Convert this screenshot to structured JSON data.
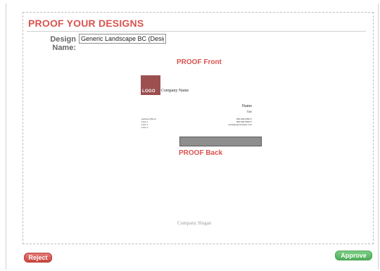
{
  "page": {
    "title": "PROOF YOUR DESIGNS"
  },
  "design": {
    "label": "Design Name:",
    "value": "Generic Landscape BC (Design Ed"
  },
  "proof": {
    "front_heading": "PROOF Front",
    "back_heading": "PROOF Back"
  },
  "card": {
    "logo_text": "LOGO",
    "company_name": "Company Name",
    "person_name": "Name",
    "person_title": "Title",
    "address_lines": [
      "Address Block",
      "Line 2",
      "Line 3",
      "Line 4"
    ],
    "contact_lines": [
      "000.000.0000 P",
      "000.000.0000 F",
      "example@example.com"
    ],
    "slogan": "Company Slogan",
    "logo_color": "#9b4f4f"
  },
  "actions": {
    "reject_label": "Reject",
    "approve_label": "Approve",
    "reject_color": "#d9534f",
    "approve_color": "#5cb85c"
  }
}
